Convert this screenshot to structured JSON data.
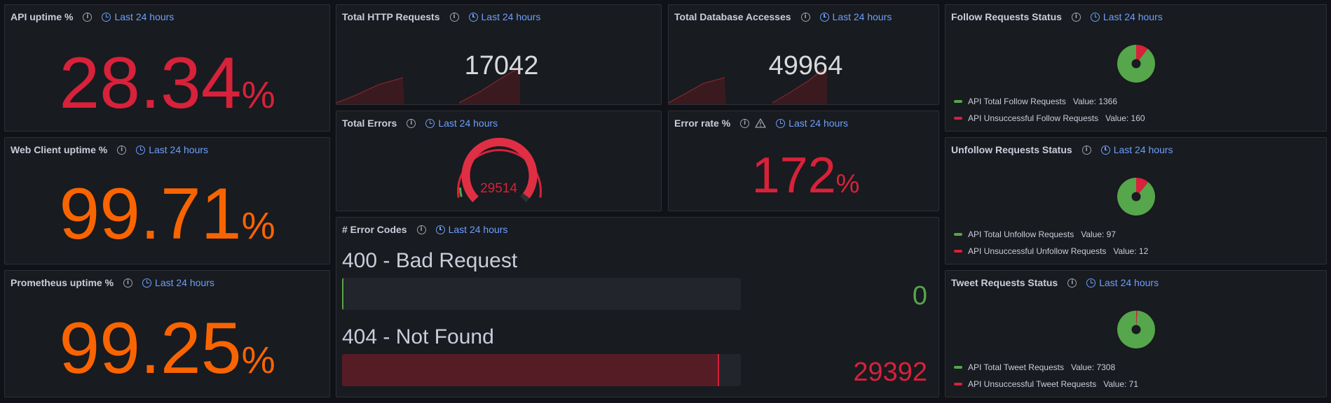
{
  "time_range_label": "Last 24 hours",
  "colors": {
    "red": "#d8213a",
    "orange": "#fa6400",
    "green": "#56a64b",
    "blue": "#6e9fff"
  },
  "panels": {
    "api_uptime": {
      "title": "API uptime %",
      "value": "28.34",
      "unit": "%",
      "color": "red"
    },
    "web_uptime": {
      "title": "Web Client uptime %",
      "value": "99.71",
      "unit": "%",
      "color": "orange"
    },
    "prom_uptime": {
      "title": "Prometheus uptime %",
      "value": "99.25",
      "unit": "%",
      "color": "orange"
    },
    "http_requests": {
      "title": "Total HTTP Requests",
      "value": "17042"
    },
    "db_accesses": {
      "title": "Total Database Accesses",
      "value": "49964"
    },
    "total_errors": {
      "title": "Total Errors",
      "value": "29514",
      "gauge_fraction": 0.97
    },
    "error_rate": {
      "title": "Error rate %",
      "value": "172",
      "unit": "%",
      "icon": "warning-icon"
    },
    "error_codes": {
      "title": "# Error Codes",
      "items": [
        {
          "name": "400 - Bad Request",
          "value": "0",
          "fraction": 0.0,
          "color": "green"
        },
        {
          "name": "404 - Not Found",
          "value": "29392",
          "fraction": 0.945,
          "color": "red"
        }
      ]
    },
    "follow": {
      "title": "Follow Requests Status",
      "legend": [
        {
          "label": "API Total Follow Requests",
          "value_label": "Value: 1366",
          "value": 1366,
          "color": "green"
        },
        {
          "label": "API Unsuccessful Follow Requests",
          "value_label": "Value: 160",
          "value": 160,
          "color": "red"
        }
      ]
    },
    "unfollow": {
      "title": "Unfollow Requests Status",
      "legend": [
        {
          "label": "API Total Unfollow Requests",
          "value_label": "Value: 97",
          "value": 97,
          "color": "green"
        },
        {
          "label": "API Unsuccessful Unfollow Requests",
          "value_label": "Value: 12",
          "value": 12,
          "color": "red"
        }
      ]
    },
    "tweet": {
      "title": "Tweet Requests Status",
      "legend": [
        {
          "label": "API Total Tweet Requests",
          "value_label": "Value: 7308",
          "value": 7308,
          "color": "green"
        },
        {
          "label": "API Unsuccessful Tweet Requests",
          "value_label": "Value: 71",
          "value": 71,
          "color": "red"
        }
      ]
    }
  }
}
